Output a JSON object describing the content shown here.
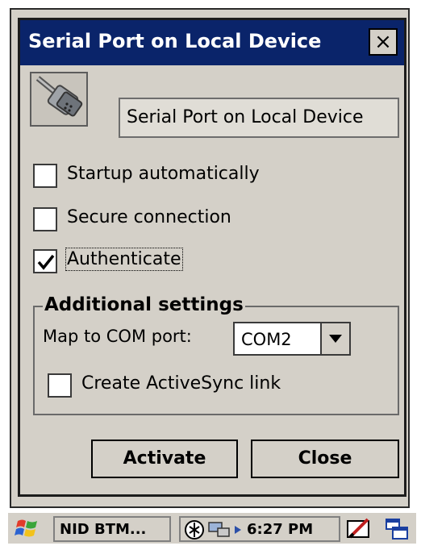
{
  "dialog": {
    "title": "Serial Port on Local Device",
    "device_name": "Serial Port on Local Device",
    "icon": "serial-port-icon",
    "close_glyph": "×"
  },
  "options": [
    {
      "label": "Startup automatically",
      "checked": false
    },
    {
      "label": "Secure connection",
      "checked": false
    },
    {
      "label": "Authenticate",
      "checked": true
    }
  ],
  "additional_settings": {
    "legend": "Additional settings",
    "map_label": "Map to COM port:",
    "com_port": "COM2",
    "activesync_label": "Create ActiveSync link",
    "activesync_checked": false
  },
  "buttons": {
    "activate": "Activate",
    "close": "Close"
  },
  "taskbar": {
    "start_icon": "windows-flag-icon",
    "task_label": "NID BTM...",
    "time": "6:27 PM"
  }
}
